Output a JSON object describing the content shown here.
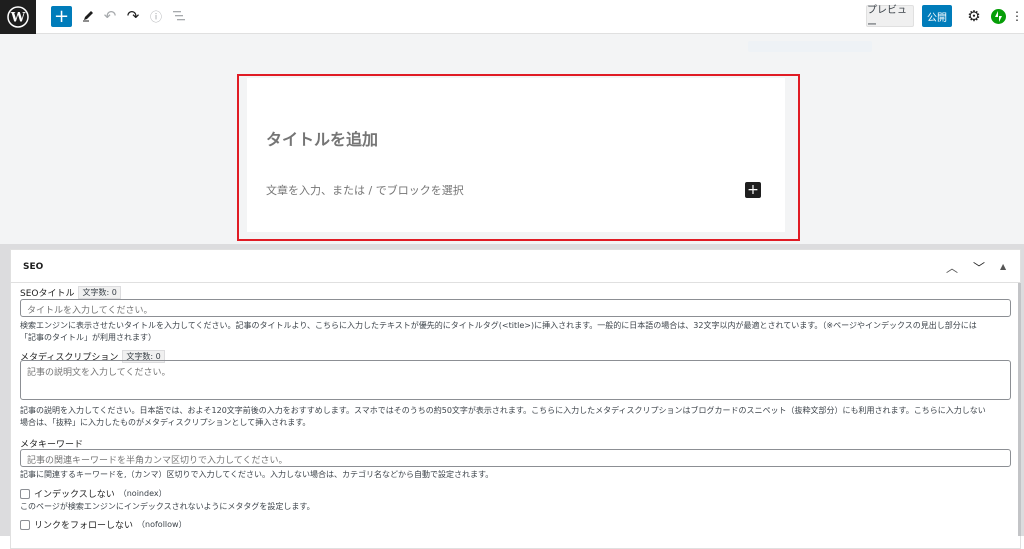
{
  "toolbar": {
    "add_icon": "plus-icon",
    "tool_icon": "pencil-icon",
    "undo_icon": "undo-icon",
    "redo_icon": "redo-icon",
    "info_icon": "info-icon",
    "list_icon": "list-view-icon",
    "preview_label": "プレビュー",
    "publish_label": "公開",
    "settings_icon": "gear-icon",
    "plugin_icon": "jetpack-icon",
    "more_icon": "vertical-dots-icon"
  },
  "editor": {
    "title_placeholder": "タイトルを追加",
    "body_placeholder": "文章を入力、または / でブロックを選択",
    "highlight_color": "#e01b24"
  },
  "seo": {
    "panel_title": "SEO",
    "seo_title": {
      "label": "SEOタイトル",
      "count": "文字数: 0",
      "placeholder": "タイトルを入力してください。",
      "help_1": "検索エンジンに表示させたいタイトルを入力してください。記事のタイトルより、こちらに入力したテキストが優先的にタイトルタグ(<title>)に挿入されます。一般的に日本語の場合は、32文字以内が最適とされています。（※ページやインデックスの見出し部分には",
      "help_2": "「記事のタイトル」が利用されます）"
    },
    "meta_description": {
      "label": "メタディスクリプション",
      "count": "文字数: 0",
      "placeholder": "記事の説明文を入力してください。",
      "help_1": "記事の説明を入力してください。日本語では、およそ120文字前後の入力をおすすめします。スマホではそのうちの約50文字が表示されます。こちらに入力したメタディスクリプションはブログカードのスニペット（抜粋文部分）にも利用されます。こちらに入力しない",
      "help_2": "場合は、「抜粋」に入力したものがメタディスクリプションとして挿入されます。"
    },
    "meta_keywords": {
      "label": "メタキーワード",
      "placeholder": "記事の関連キーワードを半角カンマ区切りで入力してください。",
      "help": "記事に関連するキーワードを,（カンマ）区切りで入力してください。入力しない場合は、カテゴリ名などから自動で設定されます。"
    },
    "noindex": {
      "label": "インデックスしない",
      "suffix": "（noindex）",
      "help": "このページが検索エンジンにインデックスされないようにメタタグを設定します。"
    },
    "nofollow": {
      "label": "リンクをフォローしない",
      "suffix": "（nofollow）"
    }
  }
}
